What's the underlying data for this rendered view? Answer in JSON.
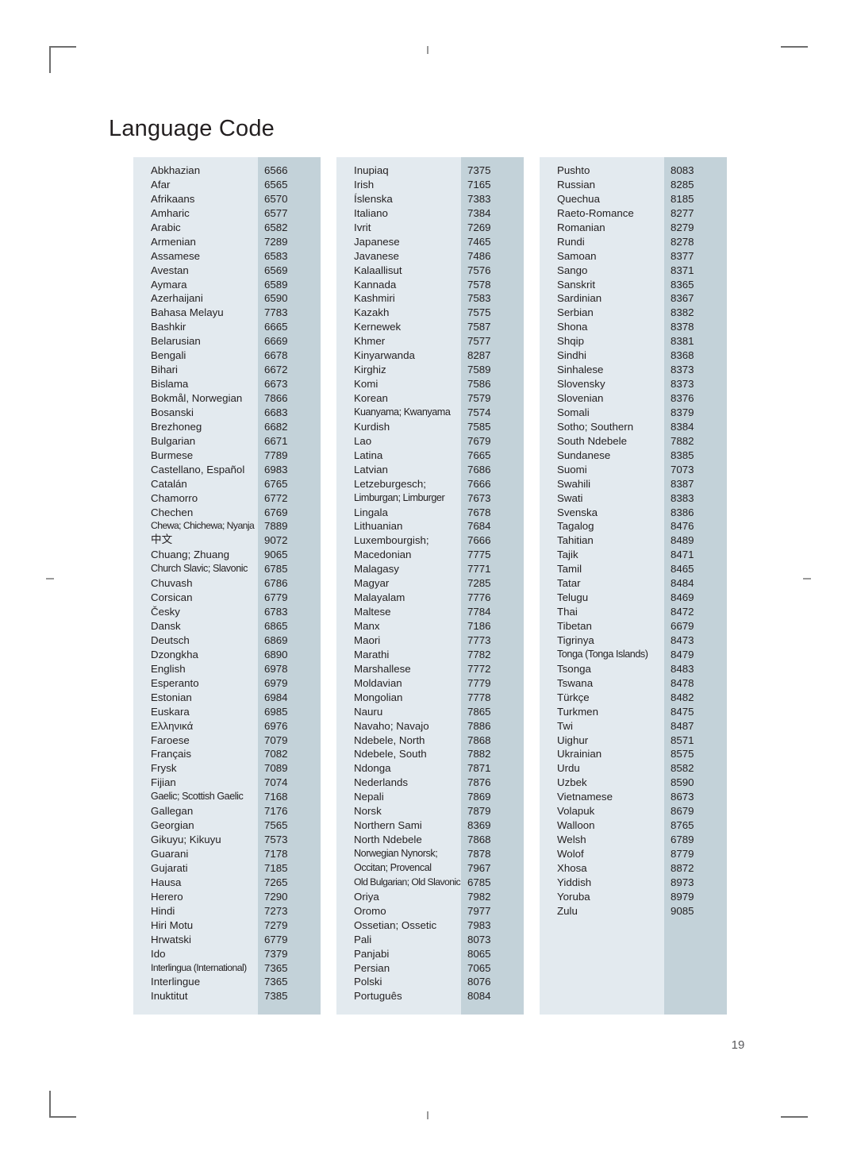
{
  "document": {
    "title": "Language Code",
    "page_number": "19"
  },
  "theme": {
    "name_column_bg": "#e3eaef",
    "code_column_bg": "#c3d2d9",
    "text_color": "#231f20",
    "page_bg": "#ffffff",
    "folio_color": "#58585b",
    "crop_mark_color": "#6e6e6e"
  },
  "columns": [
    {
      "id": "column-1",
      "rows": [
        {
          "name": "Abkhazian",
          "code": "6566"
        },
        {
          "name": "Afar",
          "code": "6565"
        },
        {
          "name": "Afrikaans",
          "code": "6570"
        },
        {
          "name": "Amharic",
          "code": "6577"
        },
        {
          "name": "Arabic",
          "code": "6582"
        },
        {
          "name": "Armenian",
          "code": "7289"
        },
        {
          "name": "Assamese",
          "code": "6583"
        },
        {
          "name": "Avestan",
          "code": "6569"
        },
        {
          "name": "Aymara",
          "code": "6589"
        },
        {
          "name": "Azerhaijani",
          "code": "6590"
        },
        {
          "name": "Bahasa Melayu",
          "code": "7783"
        },
        {
          "name": "Bashkir",
          "code": "6665"
        },
        {
          "name": "Belarusian",
          "code": "6669"
        },
        {
          "name": "Bengali",
          "code": "6678"
        },
        {
          "name": "Bihari",
          "code": "6672"
        },
        {
          "name": "Bislama",
          "code": "6673"
        },
        {
          "name": "Bokmål, Norwegian",
          "code": "7866"
        },
        {
          "name": "Bosanski",
          "code": "6683"
        },
        {
          "name": "Brezhoneg",
          "code": "6682"
        },
        {
          "name": "Bulgarian",
          "code": "6671"
        },
        {
          "name": "Burmese",
          "code": "7789"
        },
        {
          "name": "Castellano, Español",
          "code": "6983"
        },
        {
          "name": "Catalán",
          "code": "6765"
        },
        {
          "name": "Chamorro",
          "code": "6772"
        },
        {
          "name": "Chechen",
          "code": "6769"
        },
        {
          "name": "Chewa; Chichewa; Nyanja",
          "code": "7889",
          "fit": "squeeze-hard"
        },
        {
          "name": "中文",
          "code": "9072",
          "script": "cjk"
        },
        {
          "name": "Chuang; Zhuang",
          "code": "9065"
        },
        {
          "name": "Church Slavic; Slavonic",
          "code": "6785",
          "fit": "squeeze"
        },
        {
          "name": "Chuvash",
          "code": "6786"
        },
        {
          "name": "Corsican",
          "code": "6779"
        },
        {
          "name": "Česky",
          "code": "6783"
        },
        {
          "name": "Dansk",
          "code": "6865"
        },
        {
          "name": "Deutsch",
          "code": "6869"
        },
        {
          "name": "Dzongkha",
          "code": "6890"
        },
        {
          "name": "English",
          "code": "6978"
        },
        {
          "name": "Esperanto",
          "code": "6979"
        },
        {
          "name": "Estonian",
          "code": "6984"
        },
        {
          "name": "Euskara",
          "code": "6985"
        },
        {
          "name": "Ελληνικά",
          "code": "6976"
        },
        {
          "name": "Faroese",
          "code": "7079"
        },
        {
          "name": "Français",
          "code": "7082"
        },
        {
          "name": "Frysk",
          "code": "7089"
        },
        {
          "name": "Fijian",
          "code": "7074"
        },
        {
          "name": "Gaelic; Scottish Gaelic",
          "code": "7168",
          "fit": "squeeze"
        },
        {
          "name": "Gallegan",
          "code": "7176"
        },
        {
          "name": "Georgian",
          "code": "7565"
        },
        {
          "name": "Gikuyu; Kikuyu",
          "code": "7573"
        },
        {
          "name": "Guarani",
          "code": "7178"
        },
        {
          "name": "Gujarati",
          "code": "7185"
        },
        {
          "name": "Hausa",
          "code": "7265"
        },
        {
          "name": "Herero",
          "code": "7290"
        },
        {
          "name": "Hindi",
          "code": "7273"
        },
        {
          "name": "Hiri Motu",
          "code": "7279"
        },
        {
          "name": "Hrwatski",
          "code": "6779"
        },
        {
          "name": "Ido",
          "code": "7379"
        },
        {
          "name": "Interlingua (International)",
          "code": "7365",
          "fit": "squeeze-hard"
        },
        {
          "name": "Interlingue",
          "code": "7365"
        },
        {
          "name": "Inuktitut",
          "code": "7385"
        }
      ]
    },
    {
      "id": "column-2",
      "rows": [
        {
          "name": "Inupiaq",
          "code": "7375"
        },
        {
          "name": "Irish",
          "code": "7165"
        },
        {
          "name": "Íslenska",
          "code": "7383"
        },
        {
          "name": "Italiano",
          "code": "7384"
        },
        {
          "name": "Ivrit",
          "code": "7269"
        },
        {
          "name": "Japanese",
          "code": "7465"
        },
        {
          "name": "Javanese",
          "code": "7486"
        },
        {
          "name": "Kalaallisut",
          "code": "7576"
        },
        {
          "name": "Kannada",
          "code": "7578"
        },
        {
          "name": "Kashmiri",
          "code": "7583"
        },
        {
          "name": "Kazakh",
          "code": "7575"
        },
        {
          "name": "Kernewek",
          "code": "7587"
        },
        {
          "name": "Khmer",
          "code": "7577"
        },
        {
          "name": "Kinyarwanda",
          "code": "8287"
        },
        {
          "name": "Kirghiz",
          "code": "7589"
        },
        {
          "name": "Komi",
          "code": "7586"
        },
        {
          "name": "Korean",
          "code": "7579"
        },
        {
          "name": "Kuanyama; Kwanyama",
          "code": "7574",
          "fit": "squeeze"
        },
        {
          "name": "Kurdish",
          "code": "7585"
        },
        {
          "name": "Lao",
          "code": "7679"
        },
        {
          "name": "Latina",
          "code": "7665"
        },
        {
          "name": "Latvian",
          "code": "7686"
        },
        {
          "name": "Letzeburgesch;",
          "code": "7666"
        },
        {
          "name": "Limburgan; Limburger",
          "code": "7673",
          "fit": "squeeze"
        },
        {
          "name": "Lingala",
          "code": "7678"
        },
        {
          "name": "Lithuanian",
          "code": "7684"
        },
        {
          "name": "Luxembourgish;",
          "code": "7666"
        },
        {
          "name": "Macedonian",
          "code": "7775"
        },
        {
          "name": "Malagasy",
          "code": "7771"
        },
        {
          "name": "Magyar",
          "code": "7285"
        },
        {
          "name": "Malayalam",
          "code": "7776"
        },
        {
          "name": "Maltese",
          "code": "7784"
        },
        {
          "name": "Manx",
          "code": "7186"
        },
        {
          "name": "Maori",
          "code": "7773"
        },
        {
          "name": "Marathi",
          "code": "7782"
        },
        {
          "name": "Marshallese",
          "code": "7772"
        },
        {
          "name": "Moldavian",
          "code": "7779"
        },
        {
          "name": "Mongolian",
          "code": "7778"
        },
        {
          "name": "Nauru",
          "code": "7865"
        },
        {
          "name": "Navaho; Navajo",
          "code": "7886"
        },
        {
          "name": "Ndebele, North",
          "code": "7868"
        },
        {
          "name": "Ndebele, South",
          "code": "7882"
        },
        {
          "name": "Ndonga",
          "code": "7871"
        },
        {
          "name": "Nederlands",
          "code": "7876"
        },
        {
          "name": "Nepali",
          "code": "7869"
        },
        {
          "name": "Norsk",
          "code": "7879"
        },
        {
          "name": "Northern Sami",
          "code": "8369"
        },
        {
          "name": "North Ndebele",
          "code": "7868"
        },
        {
          "name": "Norwegian Nynorsk;",
          "code": "7878",
          "fit": "squeeze"
        },
        {
          "name": "Occitan; Provencal",
          "code": "7967",
          "fit": "squeeze"
        },
        {
          "name": "Old Bulgarian; Old Slavonic",
          "code": "6785",
          "fit": "squeeze-hard"
        },
        {
          "name": "Oriya",
          "code": "7982"
        },
        {
          "name": "Oromo",
          "code": "7977"
        },
        {
          "name": "Ossetian; Ossetic",
          "code": "7983"
        },
        {
          "name": "Pali",
          "code": "8073"
        },
        {
          "name": "Panjabi",
          "code": "8065"
        },
        {
          "name": "Persian",
          "code": "7065"
        },
        {
          "name": "Polski",
          "code": "8076"
        },
        {
          "name": "Português",
          "code": "8084"
        }
      ]
    },
    {
      "id": "column-3",
      "rows": [
        {
          "name": "Pushto",
          "code": "8083"
        },
        {
          "name": "Russian",
          "code": "8285"
        },
        {
          "name": "Quechua",
          "code": "8185"
        },
        {
          "name": "Raeto-Romance",
          "code": "8277"
        },
        {
          "name": "Romanian",
          "code": "8279"
        },
        {
          "name": "Rundi",
          "code": "8278"
        },
        {
          "name": "Samoan",
          "code": "8377"
        },
        {
          "name": "Sango",
          "code": "8371"
        },
        {
          "name": "Sanskrit",
          "code": "8365"
        },
        {
          "name": "Sardinian",
          "code": "8367"
        },
        {
          "name": "Serbian",
          "code": "8382"
        },
        {
          "name": "Shona",
          "code": "8378"
        },
        {
          "name": "Shqip",
          "code": "8381"
        },
        {
          "name": "Sindhi",
          "code": "8368"
        },
        {
          "name": "Sinhalese",
          "code": "8373"
        },
        {
          "name": "Slovensky",
          "code": "8373"
        },
        {
          "name": "Slovenian",
          "code": "8376"
        },
        {
          "name": "Somali",
          "code": "8379"
        },
        {
          "name": "Sotho; Southern",
          "code": "8384"
        },
        {
          "name": "South Ndebele",
          "code": "7882"
        },
        {
          "name": "Sundanese",
          "code": "8385"
        },
        {
          "name": "Suomi",
          "code": "7073"
        },
        {
          "name": "Swahili",
          "code": "8387"
        },
        {
          "name": "Swati",
          "code": "8383"
        },
        {
          "name": "Svenska",
          "code": "8386"
        },
        {
          "name": "Tagalog",
          "code": "8476"
        },
        {
          "name": "Tahitian",
          "code": "8489"
        },
        {
          "name": "Tajik",
          "code": "8471"
        },
        {
          "name": "Tamil",
          "code": "8465"
        },
        {
          "name": "Tatar",
          "code": "8484"
        },
        {
          "name": "Telugu",
          "code": "8469"
        },
        {
          "name": "Thai",
          "code": "8472"
        },
        {
          "name": "Tibetan",
          "code": "6679"
        },
        {
          "name": "Tigrinya",
          "code": "8473"
        },
        {
          "name": "Tonga (Tonga Islands)",
          "code": "8479",
          "fit": "squeeze"
        },
        {
          "name": "Tsonga",
          "code": "8483"
        },
        {
          "name": "Tswana",
          "code": "8478"
        },
        {
          "name": "Türkçe",
          "code": "8482"
        },
        {
          "name": "Turkmen",
          "code": "8475"
        },
        {
          "name": "Twi",
          "code": "8487"
        },
        {
          "name": "Uighur",
          "code": "8571"
        },
        {
          "name": "Ukrainian",
          "code": "8575"
        },
        {
          "name": "Urdu",
          "code": "8582"
        },
        {
          "name": "Uzbek",
          "code": "8590"
        },
        {
          "name": "Vietnamese",
          "code": "8673"
        },
        {
          "name": "Volapuk",
          "code": "8679"
        },
        {
          "name": "Walloon",
          "code": "8765"
        },
        {
          "name": "Welsh",
          "code": "6789"
        },
        {
          "name": "Wolof",
          "code": "8779"
        },
        {
          "name": "Xhosa",
          "code": "8872"
        },
        {
          "name": "Yiddish",
          "code": "8973"
        },
        {
          "name": "Yoruba",
          "code": "8979"
        },
        {
          "name": "Zulu",
          "code": "9085"
        }
      ]
    }
  ]
}
